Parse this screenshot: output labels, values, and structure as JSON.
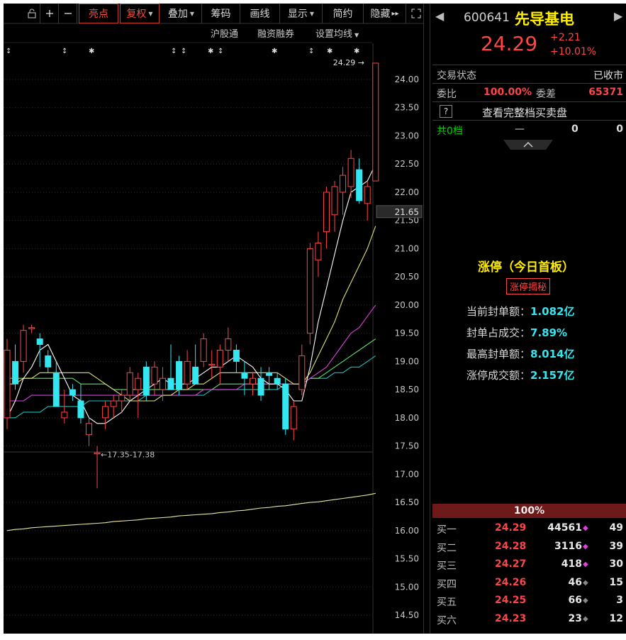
{
  "toolbar": {
    "icons": [
      "lock-icon",
      "plus-icon",
      "minus-icon"
    ],
    "highlight": "亮点",
    "fuquan": "复权",
    "overlay": "叠加",
    "chips": "筹码",
    "draw": "画线",
    "display": "显示",
    "simple": "简约",
    "hide": "隐藏",
    "hide_arrows": "▸▸",
    "fullscreen_icon": "fullscreen-icon"
  },
  "subtoolbar": {
    "hgt": "沪股通",
    "margin": "融资融券",
    "ma_settings": "设置均线"
  },
  "colors": {
    "up": "#ff4646",
    "down": "#33e6f0",
    "ma5": "#ffffff",
    "ma10": "#e0e070",
    "ma20": "#e040e0",
    "ma30": "#60e060",
    "ma60": "#20c0c0",
    "ma250": "#e8e8a0"
  },
  "chart_data": {
    "type": "candlestick",
    "y_ticks": [
      "24.00",
      "23.50",
      "23.00",
      "22.50",
      "22.00",
      "21.50",
      "21.00",
      "20.50",
      "20.00",
      "19.50",
      "19.00",
      "18.50",
      "18.00",
      "17.50",
      "17.00",
      "16.50",
      "16.00",
      "15.50",
      "15.00",
      "14.50"
    ],
    "ylim": [
      14.3,
      24.4
    ],
    "crosshair_label": "21.65",
    "crosshair_value": 21.65,
    "high_label": "24.29",
    "high_value": 24.29,
    "low_label": "17.35-17.38",
    "low_value": 17.35,
    "candles": [
      {
        "o": 18.0,
        "h": 19.4,
        "l": 17.8,
        "c": 19.2
      },
      {
        "o": 19.0,
        "h": 19.3,
        "l": 18.5,
        "c": 18.6
      },
      {
        "o": 19.0,
        "h": 19.65,
        "l": 18.8,
        "c": 19.55
      },
      {
        "o": 19.58,
        "h": 19.65,
        "l": 19.5,
        "c": 19.6
      },
      {
        "o": 19.4,
        "h": 19.5,
        "l": 18.9,
        "c": 19.3
      },
      {
        "o": 19.1,
        "h": 19.2,
        "l": 18.8,
        "c": 18.9
      },
      {
        "o": 18.8,
        "h": 19.0,
        "l": 18.2,
        "c": 18.2
      },
      {
        "o": 18.0,
        "h": 18.5,
        "l": 17.9,
        "c": 18.1
      },
      {
        "o": 18.5,
        "h": 18.6,
        "l": 18.3,
        "c": 18.4
      },
      {
        "o": 18.3,
        "h": 18.6,
        "l": 17.9,
        "c": 18.0
      },
      {
        "o": 17.7,
        "h": 18.0,
        "l": 17.5,
        "c": 17.9
      },
      {
        "o": 17.36,
        "h": 17.5,
        "l": 16.75,
        "c": 17.38
      },
      {
        "o": 18.0,
        "h": 18.3,
        "l": 17.8,
        "c": 18.2
      },
      {
        "o": 18.2,
        "h": 18.4,
        "l": 18.0,
        "c": 18.3
      },
      {
        "o": 18.3,
        "h": 18.5,
        "l": 18.1,
        "c": 18.4
      },
      {
        "o": 18.4,
        "h": 18.9,
        "l": 18.3,
        "c": 18.8
      },
      {
        "o": 18.5,
        "h": 18.8,
        "l": 18.0,
        "c": 18.7
      },
      {
        "o": 18.9,
        "h": 19.0,
        "l": 18.3,
        "c": 18.4
      },
      {
        "o": 18.6,
        "h": 19.0,
        "l": 18.4,
        "c": 18.9
      },
      {
        "o": 18.5,
        "h": 18.9,
        "l": 18.3,
        "c": 18.7
      },
      {
        "o": 18.7,
        "h": 19.3,
        "l": 18.5,
        "c": 18.5
      },
      {
        "o": 19.0,
        "h": 19.1,
        "l": 18.4,
        "c": 18.5
      },
      {
        "o": 18.6,
        "h": 19.2,
        "l": 18.5,
        "c": 19.0
      },
      {
        "o": 18.9,
        "h": 19.3,
        "l": 18.6,
        "c": 18.6
      },
      {
        "o": 19.0,
        "h": 19.5,
        "l": 18.9,
        "c": 19.4
      },
      {
        "o": 18.95,
        "h": 19.2,
        "l": 18.7,
        "c": 18.95
      },
      {
        "o": 18.9,
        "h": 19.3,
        "l": 18.6,
        "c": 19.2
      },
      {
        "o": 19.2,
        "h": 19.6,
        "l": 19.0,
        "c": 19.4
      },
      {
        "o": 19.2,
        "h": 19.3,
        "l": 18.8,
        "c": 19.0
      },
      {
        "o": 18.8,
        "h": 19.0,
        "l": 18.4,
        "c": 18.7
      },
      {
        "o": 18.6,
        "h": 18.8,
        "l": 18.4,
        "c": 18.7
      },
      {
        "o": 18.7,
        "h": 18.9,
        "l": 18.3,
        "c": 18.4
      },
      {
        "o": 18.8,
        "h": 18.9,
        "l": 18.5,
        "c": 18.75
      },
      {
        "o": 18.7,
        "h": 18.8,
        "l": 18.5,
        "c": 18.6
      },
      {
        "o": 18.6,
        "h": 18.7,
        "l": 17.7,
        "c": 17.8
      },
      {
        "o": 17.8,
        "h": 18.3,
        "l": 17.6,
        "c": 18.2
      },
      {
        "o": 18.5,
        "h": 19.3,
        "l": 18.4,
        "c": 19.1
      },
      {
        "o": 19.5,
        "h": 21.1,
        "l": 19.3,
        "c": 21.0
      },
      {
        "o": 20.8,
        "h": 21.3,
        "l": 20.5,
        "c": 21.1
      },
      {
        "o": 21.3,
        "h": 22.1,
        "l": 21.0,
        "c": 22.0
      },
      {
        "o": 21.6,
        "h": 22.2,
        "l": 21.3,
        "c": 22.1
      },
      {
        "o": 22.0,
        "h": 22.45,
        "l": 21.6,
        "c": 22.3
      },
      {
        "o": 22.1,
        "h": 22.75,
        "l": 21.9,
        "c": 22.6
      },
      {
        "o": 22.4,
        "h": 22.6,
        "l": 21.8,
        "c": 21.85
      },
      {
        "o": 21.8,
        "h": 22.2,
        "l": 21.5,
        "c": 22.1
      },
      {
        "o": 22.2,
        "h": 24.29,
        "l": 22.2,
        "c": 24.29
      }
    ],
    "ma5": [
      18.0,
      18.3,
      18.7,
      18.9,
      19.2,
      19.3,
      19.0,
      18.7,
      18.4,
      18.3,
      18.0,
      17.9,
      17.9,
      18.0,
      18.1,
      18.3,
      18.4,
      18.5,
      18.6,
      18.7,
      18.6,
      18.6,
      18.6,
      18.7,
      18.8,
      18.9,
      18.9,
      19.0,
      19.1,
      19.0,
      18.9,
      18.7,
      18.6,
      18.6,
      18.5,
      18.3,
      18.3,
      18.9,
      19.7,
      20.3,
      20.9,
      21.5,
      22.0,
      22.1,
      22.2,
      22.5
    ],
    "ma10": [
      18.6,
      18.6,
      18.7,
      18.7,
      18.8,
      18.8,
      18.8,
      18.8,
      18.8,
      18.8,
      18.8,
      18.7,
      18.6,
      18.5,
      18.4,
      18.3,
      18.3,
      18.3,
      18.3,
      18.4,
      18.4,
      18.5,
      18.5,
      18.6,
      18.6,
      18.7,
      18.8,
      18.8,
      18.8,
      18.8,
      18.8,
      18.8,
      18.8,
      18.8,
      18.7,
      18.6,
      18.6,
      18.8,
      19.1,
      19.4,
      19.7,
      20.1,
      20.4,
      20.7,
      21.0,
      21.4
    ],
    "ma20": [
      18.3,
      18.3,
      18.3,
      18.4,
      18.4,
      18.4,
      18.4,
      18.4,
      18.4,
      18.4,
      18.4,
      18.4,
      18.4,
      18.4,
      18.4,
      18.4,
      18.4,
      18.4,
      18.4,
      18.4,
      18.4,
      18.4,
      18.4,
      18.4,
      18.5,
      18.5,
      18.5,
      18.5,
      18.5,
      18.6,
      18.6,
      18.6,
      18.6,
      18.6,
      18.6,
      18.6,
      18.6,
      18.7,
      18.8,
      18.9,
      19.1,
      19.3,
      19.5,
      19.6,
      19.8,
      20.0
    ],
    "ma30": [
      18.7,
      18.7,
      18.7,
      18.7,
      18.7,
      18.7,
      18.7,
      18.7,
      18.7,
      18.6,
      18.6,
      18.6,
      18.6,
      18.5,
      18.5,
      18.5,
      18.5,
      18.5,
      18.5,
      18.5,
      18.5,
      18.5,
      18.5,
      18.5,
      18.5,
      18.5,
      18.6,
      18.6,
      18.6,
      18.6,
      18.6,
      18.6,
      18.6,
      18.6,
      18.6,
      18.6,
      18.6,
      18.7,
      18.7,
      18.8,
      18.9,
      19.0,
      19.1,
      19.2,
      19.3,
      19.4
    ],
    "ma60": [
      18.0,
      18.0,
      18.1,
      18.1,
      18.1,
      18.2,
      18.2,
      18.2,
      18.2,
      18.2,
      18.3,
      18.3,
      18.3,
      18.3,
      18.3,
      18.3,
      18.3,
      18.4,
      18.4,
      18.4,
      18.4,
      18.4,
      18.4,
      18.4,
      18.4,
      18.5,
      18.5,
      18.5,
      18.5,
      18.5,
      18.5,
      18.5,
      18.5,
      18.5,
      18.6,
      18.6,
      18.6,
      18.7,
      18.7,
      18.7,
      18.8,
      18.8,
      18.9,
      18.9,
      19.0,
      19.1
    ],
    "ma250": [
      16.0,
      16.02,
      16.03,
      16.05,
      16.06,
      16.07,
      16.08,
      16.09,
      16.1,
      16.11,
      16.12,
      16.13,
      16.14,
      16.16,
      16.17,
      16.18,
      16.19,
      16.21,
      16.22,
      16.23,
      16.24,
      16.26,
      16.27,
      16.28,
      16.29,
      16.3,
      16.32,
      16.33,
      16.35,
      16.36,
      16.38,
      16.4,
      16.41,
      16.43,
      16.44,
      16.46,
      16.48,
      16.5,
      16.51,
      16.53,
      16.55,
      16.57,
      16.59,
      16.61,
      16.63,
      16.66
    ]
  },
  "quote": {
    "code": "600641",
    "name": "先导基电",
    "price": "24.29",
    "change": "+2.21",
    "change_pct": "+10.01%",
    "status_label": "交易状态",
    "status_value": "已收市",
    "weibi_label": "委比",
    "weibi_value": "100.00%",
    "weicha_label": "委差",
    "weicha_value": "65371",
    "help": "?",
    "full_depth": "查看完整档买卖盘",
    "sell_levels": "共0档",
    "sell_dash": "—",
    "sell_zero1": "0",
    "sell_zero2": "0",
    "limit_title": "涨停（今日首板）",
    "limit_btn": "涨停揭秘",
    "seal_label": "当前封单额：",
    "seal_value": "1.082亿",
    "ratio_label": "封单占成交：",
    "ratio_value": "7.89%",
    "max_seal_label": "最高封单额：",
    "max_seal_value": "8.014亿",
    "limit_turnover_label": "涨停成交额：",
    "limit_turnover_value": "2.157亿",
    "bid_bar_pct": "100%",
    "bids": [
      {
        "label": "买一",
        "price": "24.29",
        "vol": "44561",
        "dot": "◆",
        "n": "49"
      },
      {
        "label": "买二",
        "price": "24.28",
        "vol": "3116",
        "dot": "◆",
        "n": "39"
      },
      {
        "label": "买三",
        "price": "24.27",
        "vol": "418",
        "dot": "◆",
        "n": "30"
      },
      {
        "label": "买四",
        "price": "24.26",
        "vol": "46",
        "dot": "◆",
        "n": "15"
      },
      {
        "label": "买五",
        "price": "24.25",
        "vol": "66",
        "dot": "◆",
        "n": "3"
      },
      {
        "label": "买六",
        "price": "24.23",
        "vol": "23",
        "dot": "◆",
        "n": "12"
      }
    ]
  }
}
